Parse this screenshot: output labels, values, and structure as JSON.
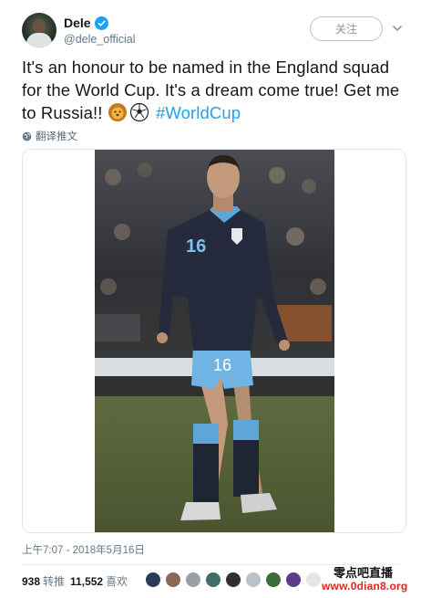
{
  "tweet": {
    "display_name": "Dele",
    "handle": "@dele_official",
    "follow_label": "关注",
    "text_main": "It's an honour to be named in the England squad for the World Cup. It's a dream come true! Get me to Russia!!",
    "emojis": [
      "lion-emoji",
      "soccer-ball-emoji"
    ],
    "hashtag": "#WorldCup",
    "translate_label": "翻译推文",
    "photo": {
      "shirt_number": "16"
    },
    "timestamp": "上午7:07 - 2018年5月16日",
    "retweets": {
      "count": "938",
      "label": "转推"
    },
    "likes": {
      "count": "11,552",
      "label": "喜欢"
    }
  },
  "watermark": {
    "title": "零点吧直播",
    "url": "www.0dian8.org"
  },
  "colors": {
    "accent": "#1da1f2",
    "text": "#14171a",
    "muted": "#657786",
    "watermark_red": "#e0261b"
  },
  "liker_avatars": [
    "#2b3b57",
    "#8a6a55",
    "#9aa0a6",
    "#3f6d6a",
    "#2f2f2f",
    "#b9c2c8",
    "#3d6b3a",
    "#5b3d8a",
    "#e6e6e6"
  ]
}
